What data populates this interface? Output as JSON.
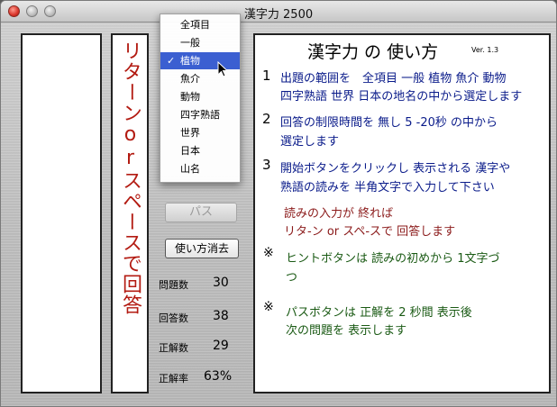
{
  "window": {
    "title": "漢字力 2500"
  },
  "vertical_text": "リターンorスペースで回答",
  "menu": {
    "items": [
      {
        "label": "全項目",
        "selected": false
      },
      {
        "label": "一般",
        "selected": false
      },
      {
        "label": "植物",
        "selected": true
      },
      {
        "label": "魚介",
        "selected": false
      },
      {
        "label": "動物",
        "selected": false
      },
      {
        "label": "四字熟語",
        "selected": false
      },
      {
        "label": "世界",
        "selected": false
      },
      {
        "label": "日本",
        "selected": false
      },
      {
        "label": "山名",
        "selected": false
      }
    ],
    "check": "✓"
  },
  "buttons": {
    "pass": "パス",
    "hide_help": "使い方消去"
  },
  "stats": [
    {
      "label": "問題数",
      "value": "30"
    },
    {
      "label": "回答数",
      "value": "38"
    },
    {
      "label": "正解数",
      "value": "29"
    },
    {
      "label": "正解率",
      "value": "63%"
    }
  ],
  "help": {
    "title": "漢字力 の 使い方",
    "version": "Ver. 1.3",
    "step1_num": "1",
    "step1_line1": "出題の範囲を　全項目 一般 植物 魚介 動物",
    "step1_line2": "四字熟語 世界 日本の地名の中から選定します",
    "step2_num": "2",
    "step2_line1": "回答の制限時間を 無し 5 -20秒 の中から",
    "step2_line2": "選定します",
    "step3_num": "3",
    "step3_line1": "開始ボタンをクリックし 表示される 漢字や",
    "step3_line2": "熟語の読みを 半角文字で入力して下さい",
    "red_line1": "読みの入力が 終れば",
    "red_line2": "リタ-ン or スペ-スで 回答します",
    "mark": "※",
    "hint_line1": "ヒントボタンは 読みの初めから 1文字づ",
    "hint_line2": "つ",
    "pass_line1": "パスボタンは 正解を 2 秒間 表示後",
    "pass_line2": "次の問題を 表示します"
  },
  "colors": {
    "vertical_red": "#b31b12",
    "help_blue": "#0a1b8a",
    "help_red": "#8b1a1a",
    "help_green": "#1a5a14",
    "menu_highlight": "#3b5fd1"
  }
}
